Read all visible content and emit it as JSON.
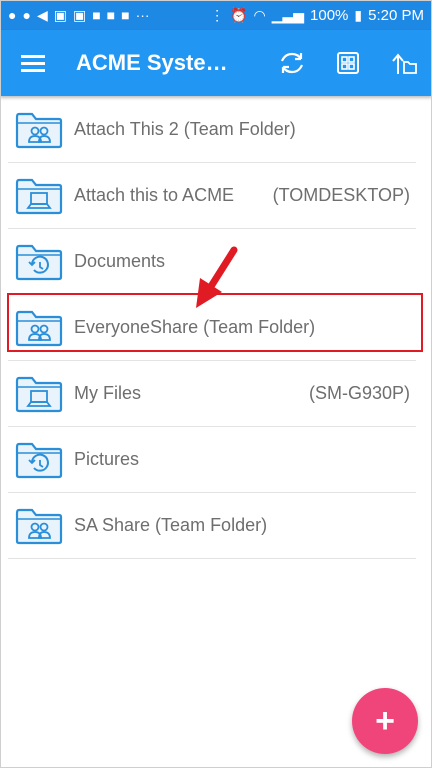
{
  "status_bar": {
    "notification_icons": [
      "pinterest-icon",
      "pinterest-icon",
      "send-icon",
      "linkedin-icon",
      "linkedin-icon",
      "youtube-icon",
      "youtube-icon",
      "youtube-icon"
    ],
    "more": "···",
    "battery": "100%",
    "time": "5:20 PM"
  },
  "toolbar": {
    "title": "ACME Syste…",
    "menu_icon": "hamburger-icon",
    "sync_icon": "sync-icon",
    "grid_icon": "grid-view-icon",
    "upload_icon": "upload-icon"
  },
  "folders": [
    {
      "label": "Attach This 2 (Team Folder)",
      "device": "",
      "icon": "team-folder-icon"
    },
    {
      "label": "Attach this to ACME",
      "device": "(TOMDESKTOP)",
      "icon": "computer-folder-icon"
    },
    {
      "label": "Documents",
      "device": "",
      "icon": "history-folder-icon"
    },
    {
      "label": "EveryoneShare (Team Folder)",
      "device": "",
      "icon": "team-folder-icon"
    },
    {
      "label": "My Files",
      "device": "(SM-G930P)",
      "icon": "computer-folder-icon"
    },
    {
      "label": "Pictures",
      "device": "",
      "icon": "history-folder-icon"
    },
    {
      "label": "SA Share (Team Folder)",
      "device": "",
      "icon": "team-folder-icon"
    }
  ],
  "fab": {
    "label": "+"
  },
  "colors": {
    "status_bar": "#1E88E5",
    "toolbar": "#2196F3",
    "fab": "#F0457A",
    "highlight": "#E01B24",
    "folder_icon": "#2A8FD8"
  }
}
